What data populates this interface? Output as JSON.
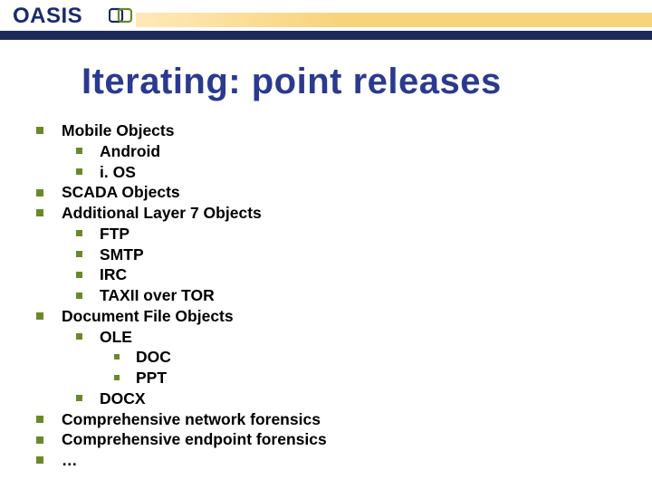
{
  "logo": {
    "text_main": "OASIS",
    "text_accent": ""
  },
  "title": "Iterating: point releases",
  "items": {
    "mobile": "Mobile Objects",
    "mobile_sub": {
      "android": "Android",
      "ios": "i. OS"
    },
    "scada": "SCADA Objects",
    "layer7": "Additional Layer 7 Objects",
    "layer7_sub": {
      "ftp": "FTP",
      "smtp": "SMTP",
      "irc": "IRC",
      "taxii": "TAXII over TOR"
    },
    "docfile": "Document File Objects",
    "docfile_sub": {
      "ole": "OLE",
      "ole_sub": {
        "doc": "DOC",
        "ppt": "PPT"
      },
      "docx": "DOCX"
    },
    "net_forensics": "Comprehensive network forensics",
    "ep_forensics": "Comprehensive endpoint forensics",
    "ellipsis": "…"
  }
}
